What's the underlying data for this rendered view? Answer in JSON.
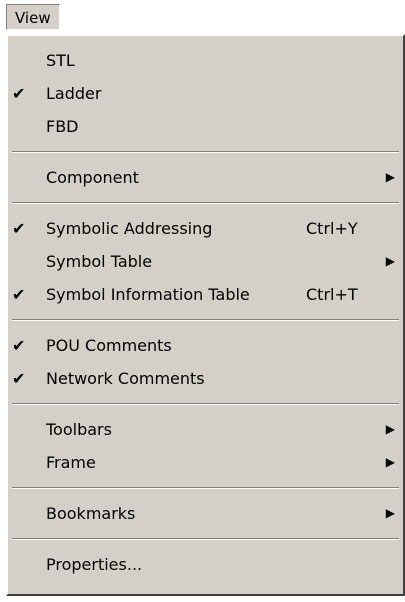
{
  "menubar": {
    "view_label": "View"
  },
  "menu": {
    "items": {
      "stl": {
        "label": "STL",
        "checked": false
      },
      "ladder": {
        "label": "Ladder",
        "checked": true
      },
      "fbd": {
        "label": "FBD",
        "checked": false
      },
      "component": {
        "label": "Component",
        "submenu": true
      },
      "symbolic_addressing": {
        "label": "Symbolic Addressing",
        "shortcut": "Ctrl+Y",
        "checked": true
      },
      "symbol_table": {
        "label": "Symbol Table",
        "submenu": true
      },
      "symbol_information_table": {
        "label": "Symbol Information Table",
        "shortcut": "Ctrl+T",
        "checked": true
      },
      "pou_comments": {
        "label": "POU Comments",
        "checked": true
      },
      "network_comments": {
        "label": "Network Comments",
        "checked": true
      },
      "toolbars": {
        "label": "Toolbars",
        "submenu": true
      },
      "frame": {
        "label": "Frame",
        "submenu": true
      },
      "bookmarks": {
        "label": "Bookmarks",
        "submenu": true
      },
      "properties": {
        "label": "Properties..."
      }
    },
    "check_glyph": "✔",
    "arrow_glyph": "▶"
  }
}
